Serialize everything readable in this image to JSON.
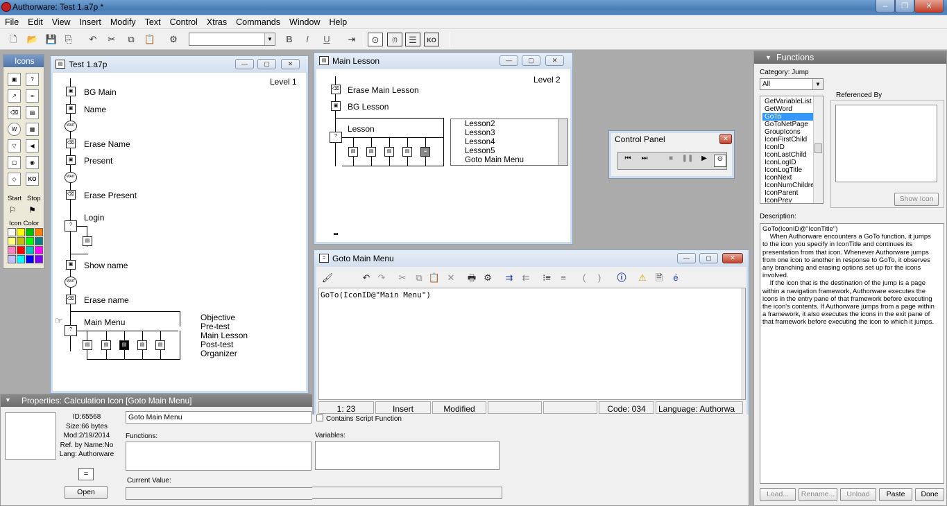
{
  "app": {
    "title": "Authorware: Test 1.a7p *",
    "min": "–",
    "max": "❐",
    "close": "✕"
  },
  "menu": [
    "File",
    "Edit",
    "View",
    "Insert",
    "Modify",
    "Text",
    "Control",
    "Xtras",
    "Commands",
    "Window",
    "Help"
  ],
  "toolbar": {
    "icons": [
      "new-icon",
      "open-icon",
      "save-all-icon",
      "import-icon",
      "undo-icon",
      "cut-icon",
      "copy-icon",
      "paste-icon",
      "find-icon"
    ],
    "font_combo": "",
    "bold": "B",
    "italic": "I",
    "underline": "U"
  },
  "icons_palette": {
    "title": "Icons",
    "start": "Start",
    "stop": "Stop",
    "color_label": "Icon Color",
    "colors": [
      "#ffffff",
      "#ffff00",
      "#00c000",
      "#ff8000",
      "#ffff80",
      "#c0c000",
      "#00ff00",
      "#008080",
      "#ff80c0",
      "#ff0000",
      "#00c0c0",
      "#ff00ff",
      "#c0c0ff",
      "#00ffff",
      "#0000ff",
      "#8000ff"
    ]
  },
  "test_window": {
    "title": "Test 1.a7p",
    "level": "Level 1",
    "items": [
      "BG Main",
      "Name",
      "Erase Name",
      "Present",
      "Erase Present",
      "Login",
      "Show name",
      "Erase name",
      "Main Menu"
    ],
    "menu_items": [
      "Objective",
      "Pre-test",
      "Main Lesson",
      "Post-test",
      "Organizer"
    ]
  },
  "lesson_window": {
    "title": "Main Lesson",
    "level": "Level 2",
    "items": [
      "Erase Main Lesson",
      "BG Lesson",
      "Lesson"
    ],
    "list": [
      "Lesson2",
      "Lesson3",
      "Lesson4",
      "Lesson5",
      "Goto Main Menu"
    ]
  },
  "control_panel": {
    "title": "Control Panel"
  },
  "goto_window": {
    "title": "Goto Main Menu",
    "code": "GoTo(IconID@\"Main Menu\")",
    "status": {
      "pos": "1: 23",
      "mode": "Insert",
      "state": "Modified",
      "code": "Code: 034",
      "lang": "Language: Authorwa"
    }
  },
  "properties": {
    "title": "Properties: Calculation Icon [Goto Main Menu]",
    "id": "ID:65568",
    "size": "Size:66 bytes",
    "mod": "Mod:2/19/2014",
    "ref": "Ref. by Name:No",
    "lang": "Lang: Authorware",
    "name_value": "Goto Main Menu",
    "functions_label": "Functions:",
    "variables_label": "Variables:",
    "current_label": "Current Value:",
    "open_button": "Open",
    "contains_label": "Contains Script Function"
  },
  "functions": {
    "title": "Functions",
    "category_label": "Category: Jump",
    "category_value": "All",
    "referenced_by": "Referenced By",
    "show_icon": "Show Icon",
    "description_label": "Description:",
    "list": [
      "GetVariableList",
      "GetWord",
      "GoTo",
      "GoToNetPage",
      "GroupIcons",
      "IconFirstChild",
      "IconID",
      "IconLastChild",
      "IconLogID",
      "IconLogTitle",
      "IconNext",
      "IconNumChildren",
      "IconParent",
      "IconPrev"
    ],
    "selected": "GoTo",
    "description": [
      "GoTo(IconID@\"IconTitle\")",
      "    When Authorware encounters a GoTo function, it jumps to the icon you specify in IconTitle and continues its presentation from that icon. Whenever Authorware jumps from one icon to another in response to GoTo, it observes any branching and erasing options set up for the icons involved.",
      "    If the icon that is the destination of the jump is a page within a navigation framework, Authorware executes the icons in the entry pane of that framework before executing the icon's contents. If Authorware jumps from a page within a framework, it also executes the icons in the exit pane of that framework before executing the icon to which it jumps."
    ],
    "buttons": {
      "load": "Load...",
      "rename": "Rename...",
      "unload": "Unload",
      "paste": "Paste",
      "done": "Done"
    }
  }
}
